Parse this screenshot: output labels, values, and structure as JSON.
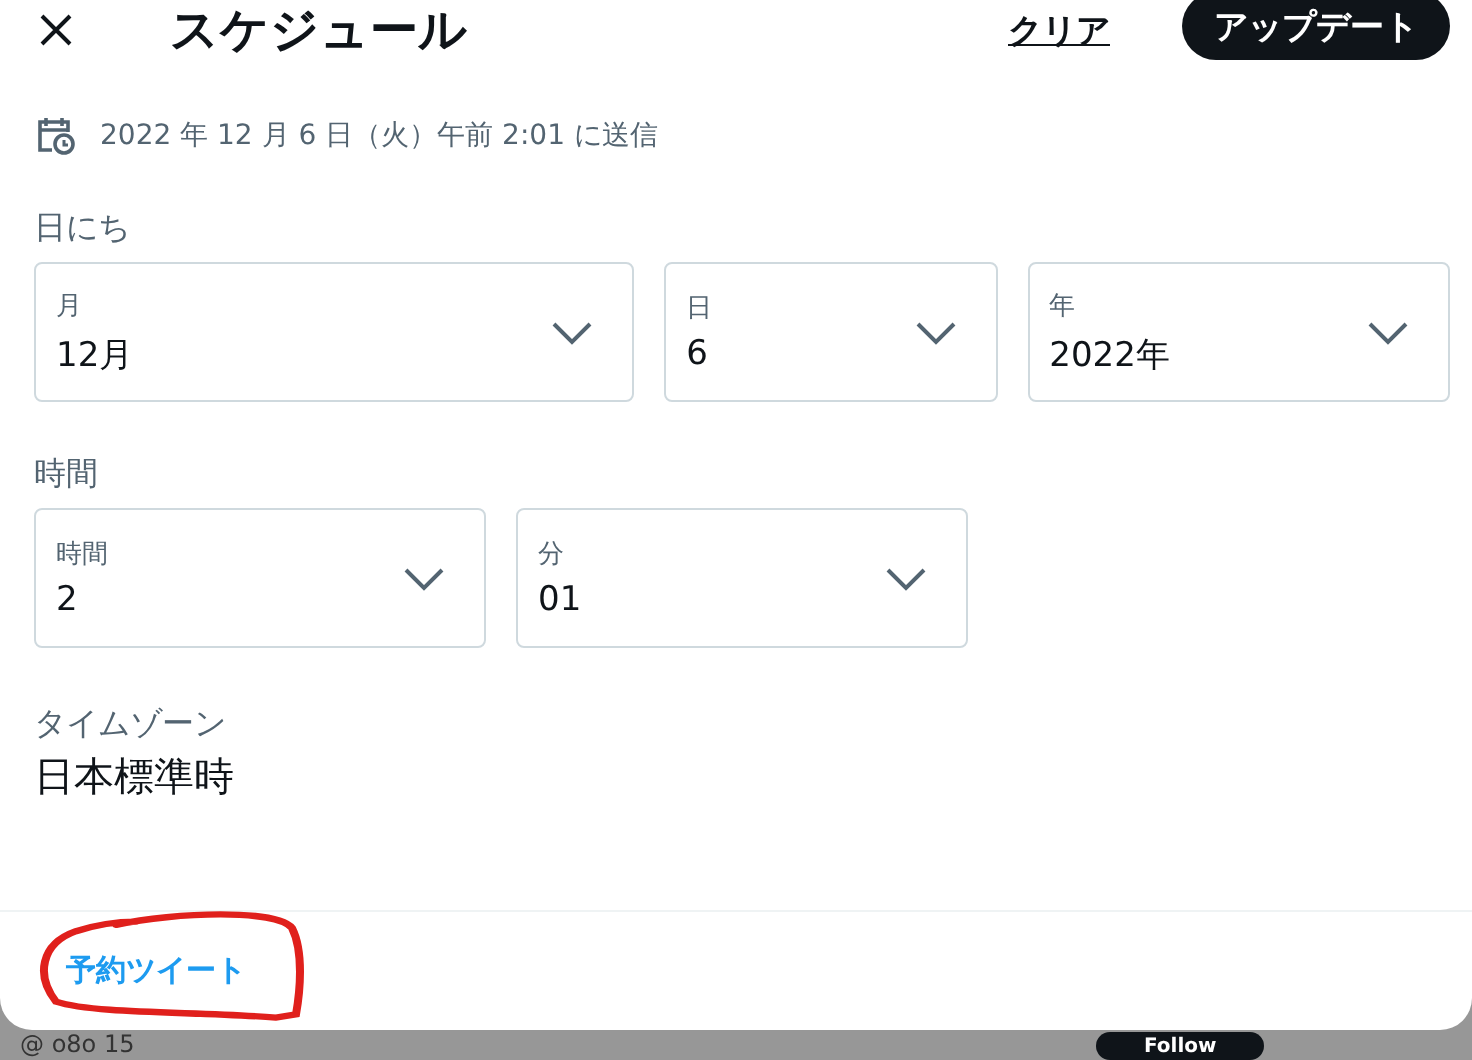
{
  "header": {
    "title": "スケジュール",
    "clear_link": "クリア",
    "update_button": "アップデート"
  },
  "send_info": "2022 年 12 月 6 日（火）午前 2:01 に送信",
  "date_section": {
    "label": "日にち",
    "selects": [
      {
        "label": "月",
        "value": "12月"
      },
      {
        "label": "日",
        "value": "6"
      },
      {
        "label": "年",
        "value": "2022年"
      }
    ]
  },
  "time_section": {
    "label": "時間",
    "selects": [
      {
        "label": "時間",
        "value": "2"
      },
      {
        "label": "分",
        "value": "01"
      }
    ]
  },
  "timezone": {
    "label": "タイムゾーン",
    "value": "日本標準時"
  },
  "footer": {
    "link": "予約ツイート"
  },
  "background": {
    "handle": "@ o8o 15",
    "button": "Follow"
  }
}
